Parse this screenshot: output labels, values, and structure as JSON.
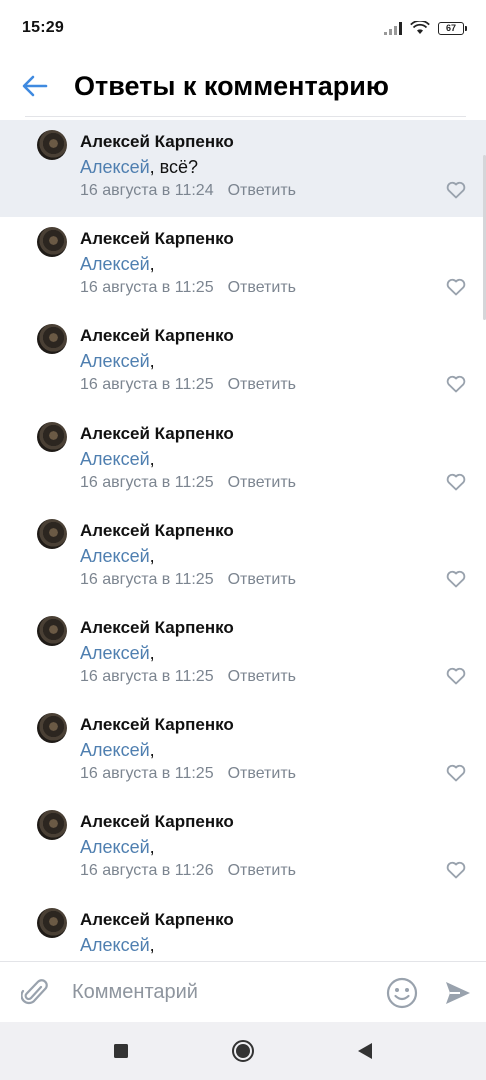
{
  "status_bar": {
    "time": "15:29",
    "battery": "67",
    "icons": [
      "signal-icon",
      "wifi-icon",
      "battery-icon"
    ]
  },
  "header": {
    "title": "Ответы к комментарию",
    "back_icon": "back-arrow-icon"
  },
  "comments": [
    {
      "author": "Алексей Карпенко",
      "mention": "Алексей",
      "text": ", всё?",
      "date": "16 августа в 11:24",
      "reply": "Ответить",
      "highlighted": true
    },
    {
      "author": "Алексей Карпенко",
      "mention": "Алексей",
      "text": ",",
      "date": "16 августа в 11:25",
      "reply": "Ответить"
    },
    {
      "author": "Алексей Карпенко",
      "mention": "Алексей",
      "text": ",",
      "date": "16 августа в 11:25",
      "reply": "Ответить"
    },
    {
      "author": "Алексей Карпенко",
      "mention": "Алексей",
      "text": ",",
      "date": "16 августа в 11:25",
      "reply": "Ответить"
    },
    {
      "author": "Алексей Карпенко",
      "mention": "Алексей",
      "text": ",",
      "date": "16 августа в 11:25",
      "reply": "Ответить"
    },
    {
      "author": "Алексей Карпенко",
      "mention": "Алексей",
      "text": ",",
      "date": "16 августа в 11:25",
      "reply": "Ответить"
    },
    {
      "author": "Алексей Карпенко",
      "mention": "Алексей",
      "text": ",",
      "date": "16 августа в 11:25",
      "reply": "Ответить"
    },
    {
      "author": "Алексей Карпенко",
      "mention": "Алексей",
      "text": ",",
      "date": "16 августа в 11:26",
      "reply": "Ответить"
    },
    {
      "author": "Алексей Карпенко",
      "mention": "Алексей",
      "text": ",",
      "date": "",
      "reply": ""
    }
  ],
  "composer": {
    "placeholder": "Комментарий",
    "attach_icon": "paperclip-icon",
    "emoji_icon": "smiley-icon",
    "send_icon": "send-icon"
  },
  "nav_bar": {
    "icons": [
      "square-recents-icon",
      "circle-home-icon",
      "triangle-back-icon"
    ]
  },
  "colors": {
    "accent": "#4f7fb0",
    "secondary_text": "#7c8590",
    "highlight_bg": "#ebeef3",
    "back_arrow": "#3f8ae0"
  }
}
